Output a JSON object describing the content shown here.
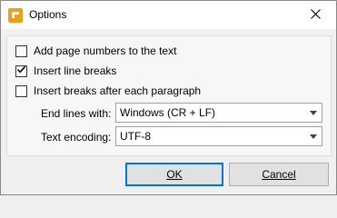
{
  "window": {
    "title": "Options",
    "icon": "app-logo-icon",
    "close_glyph": "✕"
  },
  "options": {
    "page_numbers": {
      "label": "Add page numbers to the text",
      "checked": false
    },
    "line_breaks": {
      "label": "Insert line breaks",
      "checked": true
    },
    "paragraph_breaks": {
      "label": "Insert breaks after each paragraph",
      "checked": false
    }
  },
  "fields": {
    "end_lines": {
      "label": "End lines with:",
      "value": "Windows (CR + LF)"
    },
    "encoding": {
      "label": "Text encoding:",
      "value": "UTF-8"
    }
  },
  "buttons": {
    "ok": "OK",
    "cancel": "Cancel"
  },
  "colors": {
    "accent": "#0078d7",
    "logo": "#e8a020"
  }
}
